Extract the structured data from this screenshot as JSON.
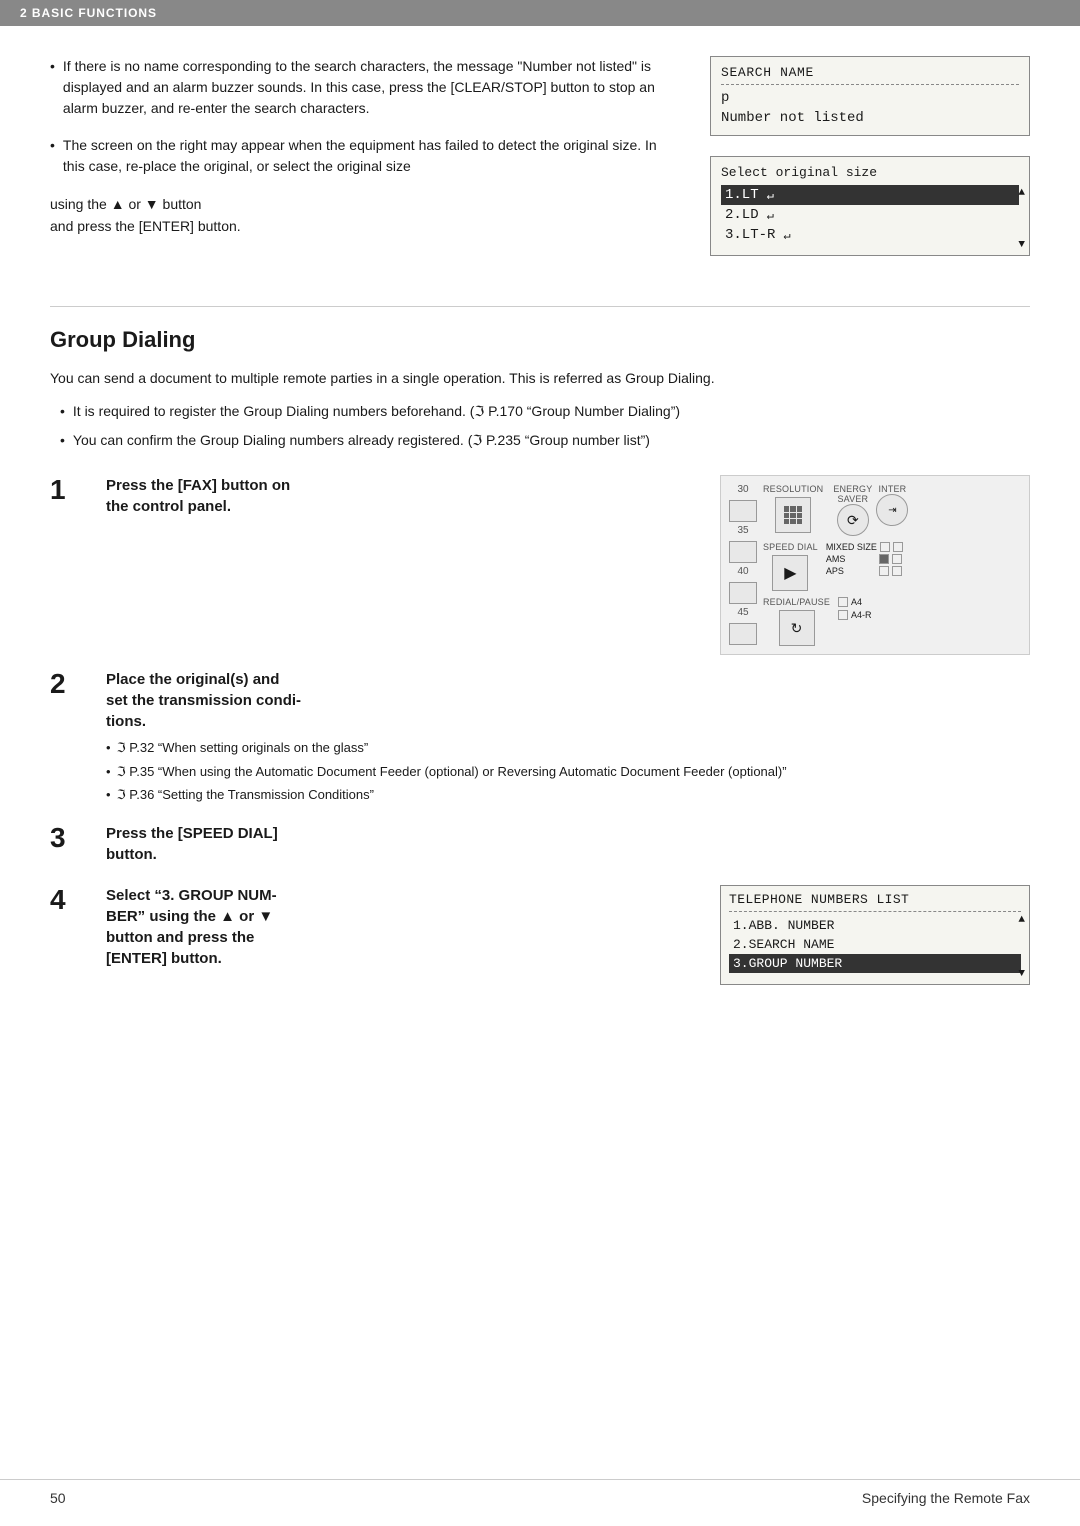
{
  "header": {
    "label": "2   BASIC FUNCTIONS"
  },
  "top_section": {
    "bullet1": {
      "text": "If there is no name corresponding to the search characters, the message \"Number not listed\" is displayed and an alarm buzzer sounds. In this case, press the [CLEAR/STOP] button to stop an alarm buzzer, and re-enter the search characters."
    },
    "bullet2": {
      "text": "The screen on the right may appear when the equipment has failed to detect the original size. In this case, re-place the original, or select the original size"
    },
    "arrow_text": "using the ▲ or ▼ button\nand press the [ENTER] button."
  },
  "search_name_box": {
    "title": "SEARCH NAME",
    "input_char": "p",
    "message": "Number not listed"
  },
  "select_original_box": {
    "title": "Select original size",
    "items": [
      {
        "label": "1.LT",
        "icon": "↵",
        "selected": true
      },
      {
        "label": "2.LD",
        "icon": "↵",
        "selected": false
      },
      {
        "label": "3.LT-R",
        "icon": "↵",
        "selected": false
      }
    ]
  },
  "group_dialing": {
    "title": "Group Dialing",
    "intro": "You can send a document to multiple remote parties in a single operation. This is referred as Group Dialing.",
    "bullets": [
      "It is required to register the Group Dialing numbers beforehand. (ℑ P.170 “Group Number Dialing”)",
      "You can confirm the Group Dialing numbers already registered. (ℑ P.235 “Group number list”)"
    ],
    "steps": [
      {
        "number": "1",
        "title": "Press the [FAX] button on the control panel.",
        "sub_bullets": [],
        "has_panel": true
      },
      {
        "number": "2",
        "title": "Place the original(s) and set the transmission conditions.",
        "sub_bullets": [
          "ℑ P.32 “When setting originals on the glass”",
          "ℑ P.35 “When using the Automatic Document Feeder (optional) or Reversing Automatic Document Feeder (optional)”",
          "ℑ P.36 “Setting the Transmission Conditions”"
        ],
        "has_panel": false
      },
      {
        "number": "3",
        "title": "Press the [SPEED DIAL] button.",
        "sub_bullets": [],
        "has_panel": false
      },
      {
        "number": "4",
        "title": "Select “3. GROUP NUMBER” using the ▲ or ▼ button and press the [ENTER] button.",
        "sub_bullets": [],
        "has_panel": true
      }
    ]
  },
  "panel": {
    "numbers": [
      "30",
      "35",
      "40",
      "45"
    ],
    "resolution_label": "RESOLUTION",
    "energy_label": "ENERGY\nSAVER",
    "interrupt_label": "INTER",
    "speed_dial_label": "SPEED DIAL",
    "redial_label": "REDIAL/PAUSE",
    "mixed_size_label": "MIXED SIZE",
    "ams_label": "AMS",
    "aps_label": "APS",
    "a4_label": "A4",
    "a4r_label": "A4-R"
  },
  "tel_numbers_box": {
    "title": "TELEPHONE NUMBERS LIST",
    "items": [
      {
        "label": "1.ABB.  NUMBER",
        "selected": false
      },
      {
        "label": "2.SEARCH NAME",
        "selected": false
      },
      {
        "label": "3.GROUP NUMBER",
        "selected": true
      }
    ]
  },
  "footer": {
    "page_number": "50",
    "text": "Specifying the Remote Fax"
  }
}
